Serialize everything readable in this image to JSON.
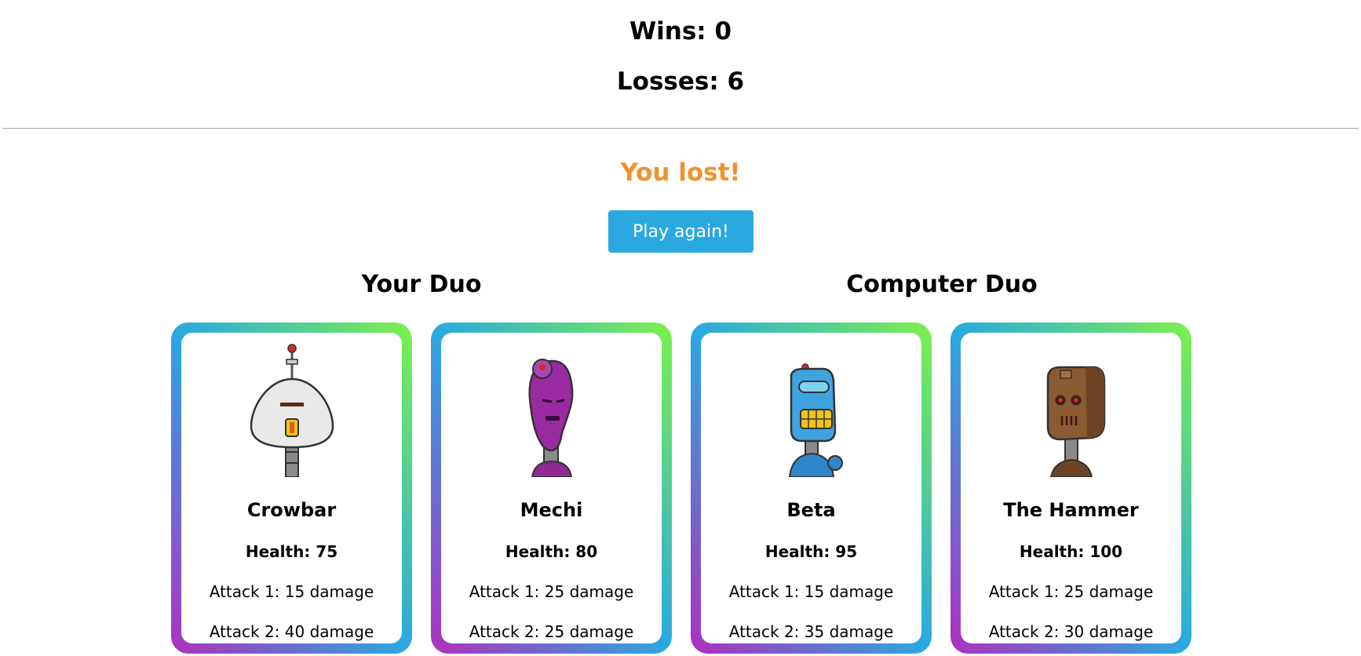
{
  "scoreboard": {
    "wins": "Wins: 0",
    "losses": "Losses: 6"
  },
  "result_text": "You lost!",
  "play_again_label": "Play again!",
  "player_duo_title": "Your Duo",
  "computer_duo_title": "Computer Duo",
  "colors": {
    "result": "#f0922e",
    "button": "#2aa9e0",
    "card_gradient": [
      "#b02fbf",
      "#2aa9e0",
      "#7df24a"
    ]
  },
  "robots": [
    {
      "name": "Crowbar",
      "health": "Health: 75",
      "attack1": "Attack 1: 15 damage",
      "attack2": "Attack 2: 40 damage",
      "icon": "white-robot-icon"
    },
    {
      "name": "Mechi",
      "health": "Health: 80",
      "attack1": "Attack 1: 25 damage",
      "attack2": "Attack 2: 25 damage",
      "icon": "purple-robot-icon"
    },
    {
      "name": "Beta",
      "health": "Health: 95",
      "attack1": "Attack 1: 15 damage",
      "attack2": "Attack 2: 35 damage",
      "icon": "blue-robot-icon"
    },
    {
      "name": "The Hammer",
      "health": "Health: 100",
      "attack1": "Attack 1: 25 damage",
      "attack2": "Attack 2: 30 damage",
      "icon": "brown-robot-icon"
    }
  ]
}
